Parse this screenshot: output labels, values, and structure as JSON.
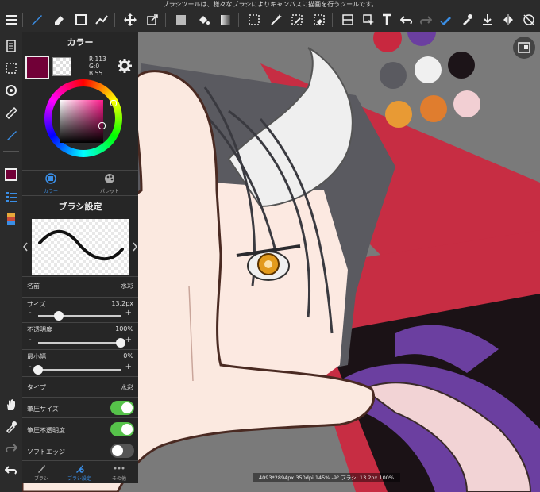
{
  "hint_text": "ブラシツールは、様々なブラシによりキャンバスに描画を行うツールです。",
  "color_panel": {
    "title": "カラー",
    "r_text": "R:113",
    "g_text": "G:0",
    "b_text": "B:55",
    "tab_color": "カラー",
    "tab_palette": "パレット",
    "current_color": "#710037"
  },
  "brush_settings": {
    "title": "ブラシ設定",
    "name_label": "名前",
    "name_value": "水彩",
    "size_label": "サイズ",
    "size_value": "13.2px",
    "size_level": 0.25,
    "opacity_label": "不透明度",
    "opacity_value": "100%",
    "opacity_level": 1.0,
    "minwidth_label": "最小幅",
    "minwidth_value": "0%",
    "minwidth_level": 0.0,
    "type_label": "タイプ",
    "type_value": "水彩",
    "pressure_size_label": "筆圧サイズ",
    "pressure_size_on": true,
    "pressure_opacity_label": "筆圧不透明度",
    "pressure_opacity_on": true,
    "soft_edge_label": "ソフトエッジ",
    "soft_edge_on": false
  },
  "bottom_tabs": {
    "brush": "ブラシ",
    "brush_settings": "ブラシ設定",
    "other": "その他"
  },
  "status_text": "4093*2894px 350dpi 145% -9° ブラシ: 13.2px 100%",
  "canvas_palette_colors": [
    "#c8283f",
    "#6b3fa0",
    "#5a5a60",
    "#f0f0f0",
    "#1c1418",
    "#e89a34",
    "#e07d2e",
    "#f2cfd3"
  ],
  "accent_color": "#3a8ee6",
  "toggle_on_color": "#56c24a"
}
